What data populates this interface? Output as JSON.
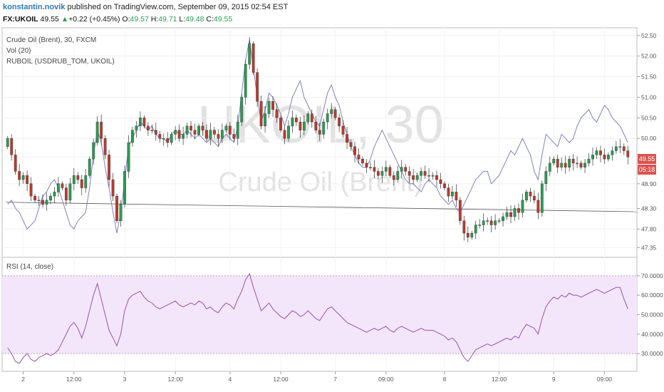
{
  "header": {
    "author": "konstantin.novik",
    "published_text": " published on TradingView.com, September 09, 2015 02:54 EST",
    "symbol": "FX:UKOIL",
    "last": "49.55",
    "arrow": "▲",
    "change": "+0.22 (+0.45%)",
    "o_label": "O:",
    "o_value": "49.57",
    "h_label": "H:",
    "h_value": "49.71",
    "l_label": "L:",
    "l_value": "49.48",
    "c_label": "C:",
    "c_value": "49.55"
  },
  "legend": {
    "main": "Crude Oil (Brent), 30, FXCM",
    "vol": "Vol (20)",
    "ruboil": "RUBOIL (USDRUB_TOM, UKOIL)",
    "rsi": "RSI (14, close)"
  },
  "watermark": {
    "symbol": "UKOIL, 30",
    "name": "Crude Oil (Brent)"
  },
  "badges": {
    "price": "49.55",
    "timer": "05:18"
  },
  "colors": {
    "up": "#2a9d54",
    "down": "#c0392b",
    "line": "#8080c0",
    "rsi_line": "#9b4fb0",
    "rsi_band": "#f3e6fb",
    "badge": "#d9534f"
  },
  "chart_data": [
    {
      "type": "candlestick",
      "title": "Crude Oil (Brent), 30, FXCM",
      "ylim": [
        47.2,
        52.6
      ],
      "y_ticks": [
        "52.50",
        "52.00",
        "51.50",
        "51.00",
        "50.50",
        "50.00",
        "49.55",
        "48.90",
        "48.30",
        "47.80",
        "47.35"
      ],
      "x_ticks": [
        "2",
        "12:00",
        "3",
        "12:00",
        "4",
        "12:00",
        "7",
        "09:00",
        "8",
        "12:00",
        "9",
        "09:00"
      ],
      "last_price": 49.55,
      "close": [
        50.0,
        49.6,
        49.2,
        49.0,
        49.1,
        48.9,
        48.6,
        48.5,
        48.5,
        48.4,
        48.5,
        48.6,
        48.7,
        48.9,
        48.8,
        48.5,
        48.9,
        49.1,
        49.0,
        48.8,
        49.1,
        49.5,
        49.9,
        50.4,
        50.0,
        49.6,
        49.0,
        48.6,
        48.0,
        48.4,
        49.2,
        49.9,
        50.2,
        50.3,
        50.5,
        50.3,
        50.2,
        50.2,
        50.1,
        50.0,
        50.0,
        49.9,
        50.1,
        50.2,
        50.0,
        50.1,
        50.3,
        50.2,
        50.1,
        50.3,
        50.2,
        50.0,
        50.2,
        50.1,
        50.0,
        50.2,
        50.3,
        50.1,
        50.0,
        50.4,
        51.0,
        51.8,
        52.3,
        51.6,
        50.9,
        50.3,
        50.6,
        50.9,
        50.7,
        50.5,
        50.2,
        50.0,
        50.3,
        50.5,
        50.4,
        50.2,
        50.4,
        50.6,
        50.4,
        50.2,
        50.1,
        50.4,
        50.6,
        50.7,
        50.5,
        50.3,
        50.1,
        49.9,
        49.8,
        49.6,
        49.5,
        49.4,
        49.3,
        49.3,
        49.2,
        49.1,
        49.2,
        49.3,
        49.1,
        49.0,
        49.2,
        49.3,
        49.2,
        49.1,
        49.0,
        49.1,
        49.2,
        49.1,
        49.1,
        49.1,
        49.0,
        48.9,
        48.8,
        48.6,
        48.7,
        48.5,
        48.0,
        47.7,
        47.6,
        47.7,
        47.9,
        47.9,
        48.0,
        48.0,
        47.9,
        48.0,
        48.0,
        48.1,
        48.2,
        48.1,
        48.3,
        48.2,
        48.5,
        48.7,
        48.6,
        48.5,
        48.2,
        48.9,
        49.2,
        49.4,
        49.5,
        49.3,
        49.4,
        49.3,
        49.5,
        49.4,
        49.4,
        49.3,
        49.4,
        49.5,
        49.6,
        49.7,
        49.6,
        49.5,
        49.6,
        49.7,
        49.8,
        49.8,
        49.7,
        49.55
      ],
      "x": "sequential 30-minute bars (index 0–159)"
    },
    {
      "type": "line",
      "title": "RUBOIL (USDRUB_TOM, UKOIL)",
      "values_on_price_scale": [
        48.4,
        48.5,
        48.3,
        48.2,
        48.0,
        47.8,
        47.9,
        48.0,
        48.3,
        48.6,
        48.7,
        48.9,
        49.0,
        48.8,
        48.5,
        48.2,
        47.9,
        47.8,
        48.0,
        48.1,
        48.2,
        48.8,
        49.6,
        50.2,
        49.9,
        49.3,
        48.8,
        48.2,
        47.7,
        48.2,
        49.0,
        49.8,
        50.0,
        50.2,
        50.4,
        50.3,
        50.2,
        50.3,
        50.1,
        50.0,
        50.0,
        49.9,
        50.1,
        50.2,
        50.1,
        50.1,
        50.2,
        50.1,
        50.0,
        50.1,
        50.0,
        49.9,
        50.0,
        49.9,
        49.8,
        50.0,
        50.1,
        50.0,
        49.9,
        50.3,
        51.1,
        51.9,
        52.4,
        51.7,
        51.0,
        50.4,
        50.7,
        51.1,
        51.0,
        50.8,
        50.6,
        50.3,
        50.6,
        51.0,
        51.2,
        51.4,
        51.0,
        50.8,
        50.6,
        50.4,
        50.3,
        50.7,
        51.1,
        51.3,
        51.0,
        50.8,
        50.4,
        50.1,
        49.8,
        49.6,
        49.4,
        49.3,
        49.3,
        49.5,
        49.8,
        50.0,
        50.2,
        50.0,
        49.8,
        49.6,
        49.4,
        49.2,
        49.0,
        48.9,
        48.9,
        48.8,
        48.7,
        48.9,
        49.0,
        48.9,
        48.8,
        48.6,
        48.5,
        48.4,
        48.5,
        48.3,
        48.2,
        48.4,
        48.6,
        48.8,
        49.0,
        49.1,
        49.2,
        49.2,
        48.9,
        49.0,
        49.1,
        49.3,
        49.5,
        49.7,
        49.6,
        49.8,
        50.0,
        49.8,
        49.6,
        49.2,
        49.0,
        49.6,
        50.1,
        50.0,
        49.9,
        49.8,
        50.1,
        50.0,
        49.9,
        50.0,
        50.3,
        50.5,
        50.6,
        50.7,
        50.5,
        50.4,
        50.6,
        50.8,
        50.7,
        50.5,
        50.4,
        50.3,
        50.1,
        49.9
      ]
    },
    {
      "type": "line",
      "title": "RSI (14, close)",
      "ylim": [
        22,
        78
      ],
      "y_ticks": [
        "70.0000",
        "60.0000",
        "50.0000",
        "40.0000",
        "30.0000"
      ],
      "band": [
        30,
        70
      ],
      "values": [
        33,
        30,
        26,
        25,
        28,
        30,
        27,
        26,
        28,
        29,
        30,
        29,
        30,
        32,
        36,
        40,
        44,
        46,
        43,
        38,
        44,
        52,
        60,
        66,
        58,
        50,
        42,
        38,
        34,
        40,
        52,
        58,
        60,
        61,
        62,
        59,
        57,
        56,
        54,
        53,
        54,
        55,
        56,
        57,
        55,
        54,
        55,
        56,
        55,
        57,
        56,
        53,
        54,
        52,
        51,
        54,
        56,
        55,
        53,
        58,
        62,
        68,
        71,
        64,
        58,
        52,
        54,
        56,
        53,
        51,
        49,
        48,
        50,
        52,
        51,
        49,
        50,
        52,
        50,
        48,
        47,
        50,
        53,
        54,
        52,
        50,
        48,
        46,
        45,
        44,
        43,
        42,
        41,
        42,
        43,
        42,
        43,
        44,
        42,
        41,
        43,
        44,
        43,
        42,
        41,
        42,
        43,
        42,
        42,
        42,
        41,
        40,
        39,
        37,
        38,
        36,
        32,
        28,
        26,
        29,
        32,
        33,
        34,
        35,
        34,
        35,
        36,
        37,
        38,
        37,
        39,
        38,
        42,
        45,
        44,
        43,
        40,
        48,
        54,
        57,
        59,
        58,
        60,
        59,
        61,
        60,
        60,
        59,
        60,
        61,
        62,
        63,
        62,
        61,
        62,
        63,
        64,
        64,
        58,
        53
      ]
    },
    {
      "type": "bar",
      "title": "Vol (20)",
      "note": "volume bars not visible in screenshot"
    }
  ]
}
